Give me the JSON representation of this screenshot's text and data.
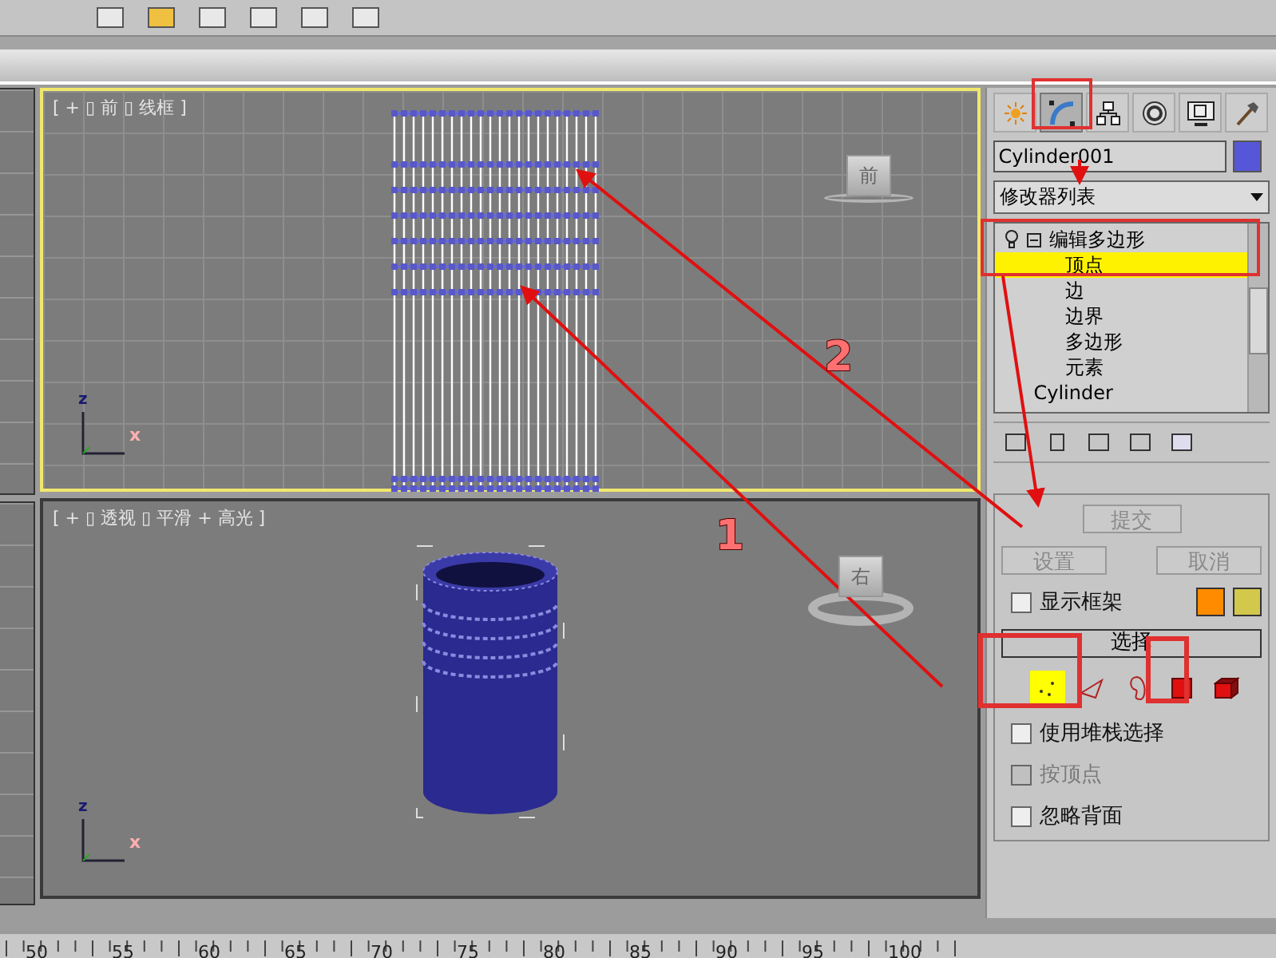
{
  "viewports": [
    {
      "label": "[ + ▯ 前 ▯ 线框 ]",
      "active": true,
      "kind": "front",
      "cube_label": "前",
      "axis_labels": [
        "z",
        "x"
      ]
    },
    {
      "label": "[ + ▯ 透视 ▯ 平滑 + 高光 ]",
      "active": false,
      "kind": "perspective",
      "cube_label": "右",
      "axis_labels": [
        "z",
        "x"
      ]
    }
  ],
  "panel": {
    "tabs": [
      {
        "kind": "create",
        "selected": false
      },
      {
        "kind": "modify",
        "selected": true
      },
      {
        "kind": "hierarchy",
        "selected": false
      },
      {
        "kind": "motion",
        "selected": false
      },
      {
        "kind": "display",
        "selected": false
      },
      {
        "kind": "utilities",
        "selected": false
      }
    ],
    "object_name": "Cylinder001",
    "modifier_list": "修改器列表",
    "stack": [
      {
        "label": "编辑多边形",
        "expanded": true,
        "children": [
          {
            "label": "顶点",
            "selected": true
          },
          {
            "label": "边",
            "selected": false
          },
          {
            "label": "边界",
            "selected": false
          },
          {
            "label": "多边形",
            "selected": false
          },
          {
            "label": "元素",
            "selected": false
          }
        ]
      },
      {
        "label": "Cylinder"
      }
    ],
    "rollout": {
      "buttons": [
        {
          "label": "提交",
          "disabled": true
        },
        {
          "label": "设置",
          "disabled": true
        },
        {
          "label": "取消",
          "disabled": true
        }
      ],
      "show_cage": {
        "label": "显示框架",
        "checked": false
      },
      "section": "选择",
      "subobjects": [
        {
          "kind": "vertex",
          "selected": true
        },
        {
          "kind": "edge",
          "selected": false
        },
        {
          "kind": "border",
          "selected": false
        },
        {
          "kind": "polygon",
          "selected": false
        },
        {
          "kind": "element",
          "selected": false
        }
      ],
      "options": [
        {
          "label": "使用堆栈选择",
          "checked": false,
          "disabled": false
        },
        {
          "label": "按顶点",
          "checked": false,
          "disabled": true
        },
        {
          "label": "忽略背面",
          "checked": false,
          "disabled": false
        }
      ]
    }
  },
  "timeline": {
    "ticks": [
      "50",
      "55",
      "60",
      "65",
      "70",
      "75",
      "80",
      "85",
      "90",
      "95",
      "100"
    ]
  },
  "annotations": {
    "numbers": [
      "2",
      "1"
    ]
  }
}
